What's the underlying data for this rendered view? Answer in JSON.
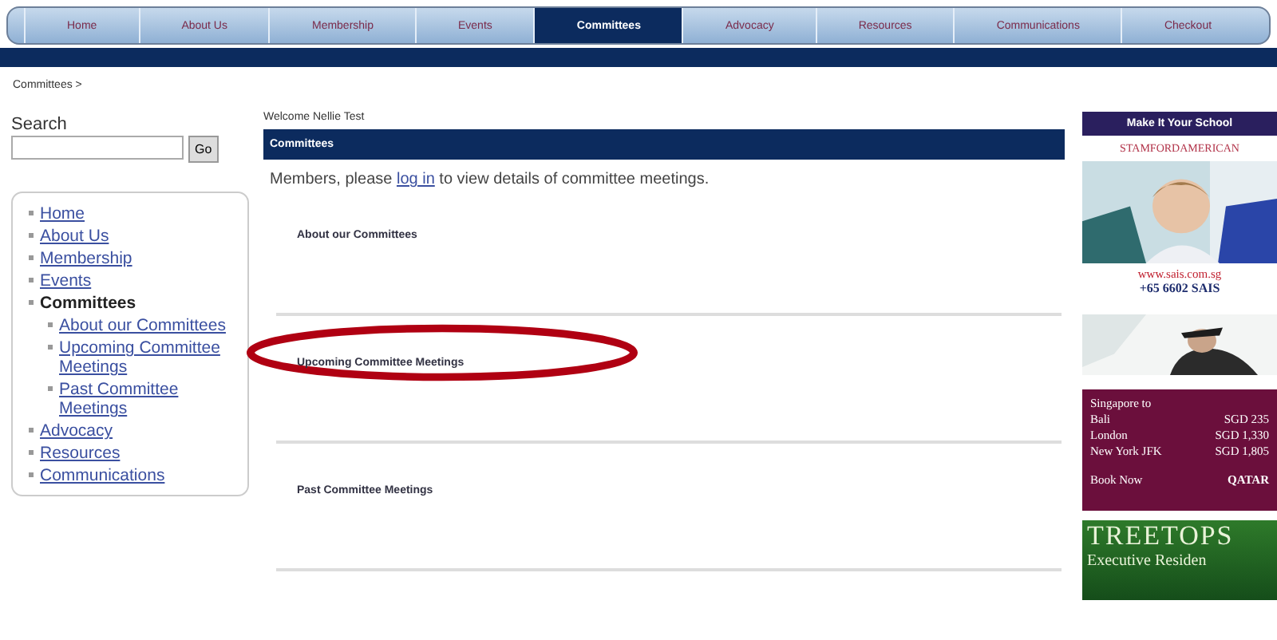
{
  "nav": [
    {
      "label": "Home",
      "selected": false
    },
    {
      "label": "About Us",
      "selected": false
    },
    {
      "label": "Membership",
      "selected": false
    },
    {
      "label": "Events",
      "selected": false
    },
    {
      "label": "Committees",
      "selected": true
    },
    {
      "label": "Advocacy",
      "selected": false
    },
    {
      "label": "Resources",
      "selected": false
    },
    {
      "label": "Communications",
      "selected": false
    },
    {
      "label": "Checkout",
      "selected": false
    }
  ],
  "breadcrumb": "Committees >",
  "search": {
    "label": "Search",
    "button": "Go"
  },
  "sidebar": {
    "items": [
      {
        "label": "Home",
        "selected": false
      },
      {
        "label": "About Us",
        "selected": false
      },
      {
        "label": "Membership",
        "selected": false
      },
      {
        "label": "Events",
        "selected": false
      },
      {
        "label": "Committees",
        "selected": true,
        "children": [
          {
            "label": "About our Committees",
            "selected": false
          },
          {
            "label": "Upcoming Committee Meetings",
            "selected": false
          },
          {
            "label": "Past Committee Meetings",
            "selected": false
          }
        ]
      },
      {
        "label": "Advocacy",
        "selected": false
      },
      {
        "label": "Resources",
        "selected": false
      },
      {
        "label": "Communications",
        "selected": false
      }
    ]
  },
  "welcome": "Welcome Nellie Test",
  "page_title": "Committees",
  "notice": {
    "before": "Members, please ",
    "link": "log in",
    "after": " to view details of committee meetings."
  },
  "sections": [
    {
      "title": "About our Committees",
      "highlighted": false
    },
    {
      "title": "Upcoming Committee Meetings",
      "highlighted": true
    },
    {
      "title": "Past Committee Meetings",
      "highlighted": false
    }
  ],
  "ads": {
    "school": {
      "header": "Make It Your School",
      "brand": "STAMFORDAMERICAN",
      "url": "www.sais.com.sg",
      "phone": "+65 6602 SAIS"
    },
    "airline": {
      "heading": "Singapore to",
      "fares": [
        {
          "city": "Bali",
          "price": "SGD 235"
        },
        {
          "city": "London",
          "price": "SGD 1,330"
        },
        {
          "city": "New York JFK",
          "price": "SGD 1,805"
        }
      ],
      "cta": "Book Now",
      "brand": "QATAR"
    },
    "residence": {
      "title": "TREETOPS",
      "subtitle": "Executive Residen"
    }
  }
}
